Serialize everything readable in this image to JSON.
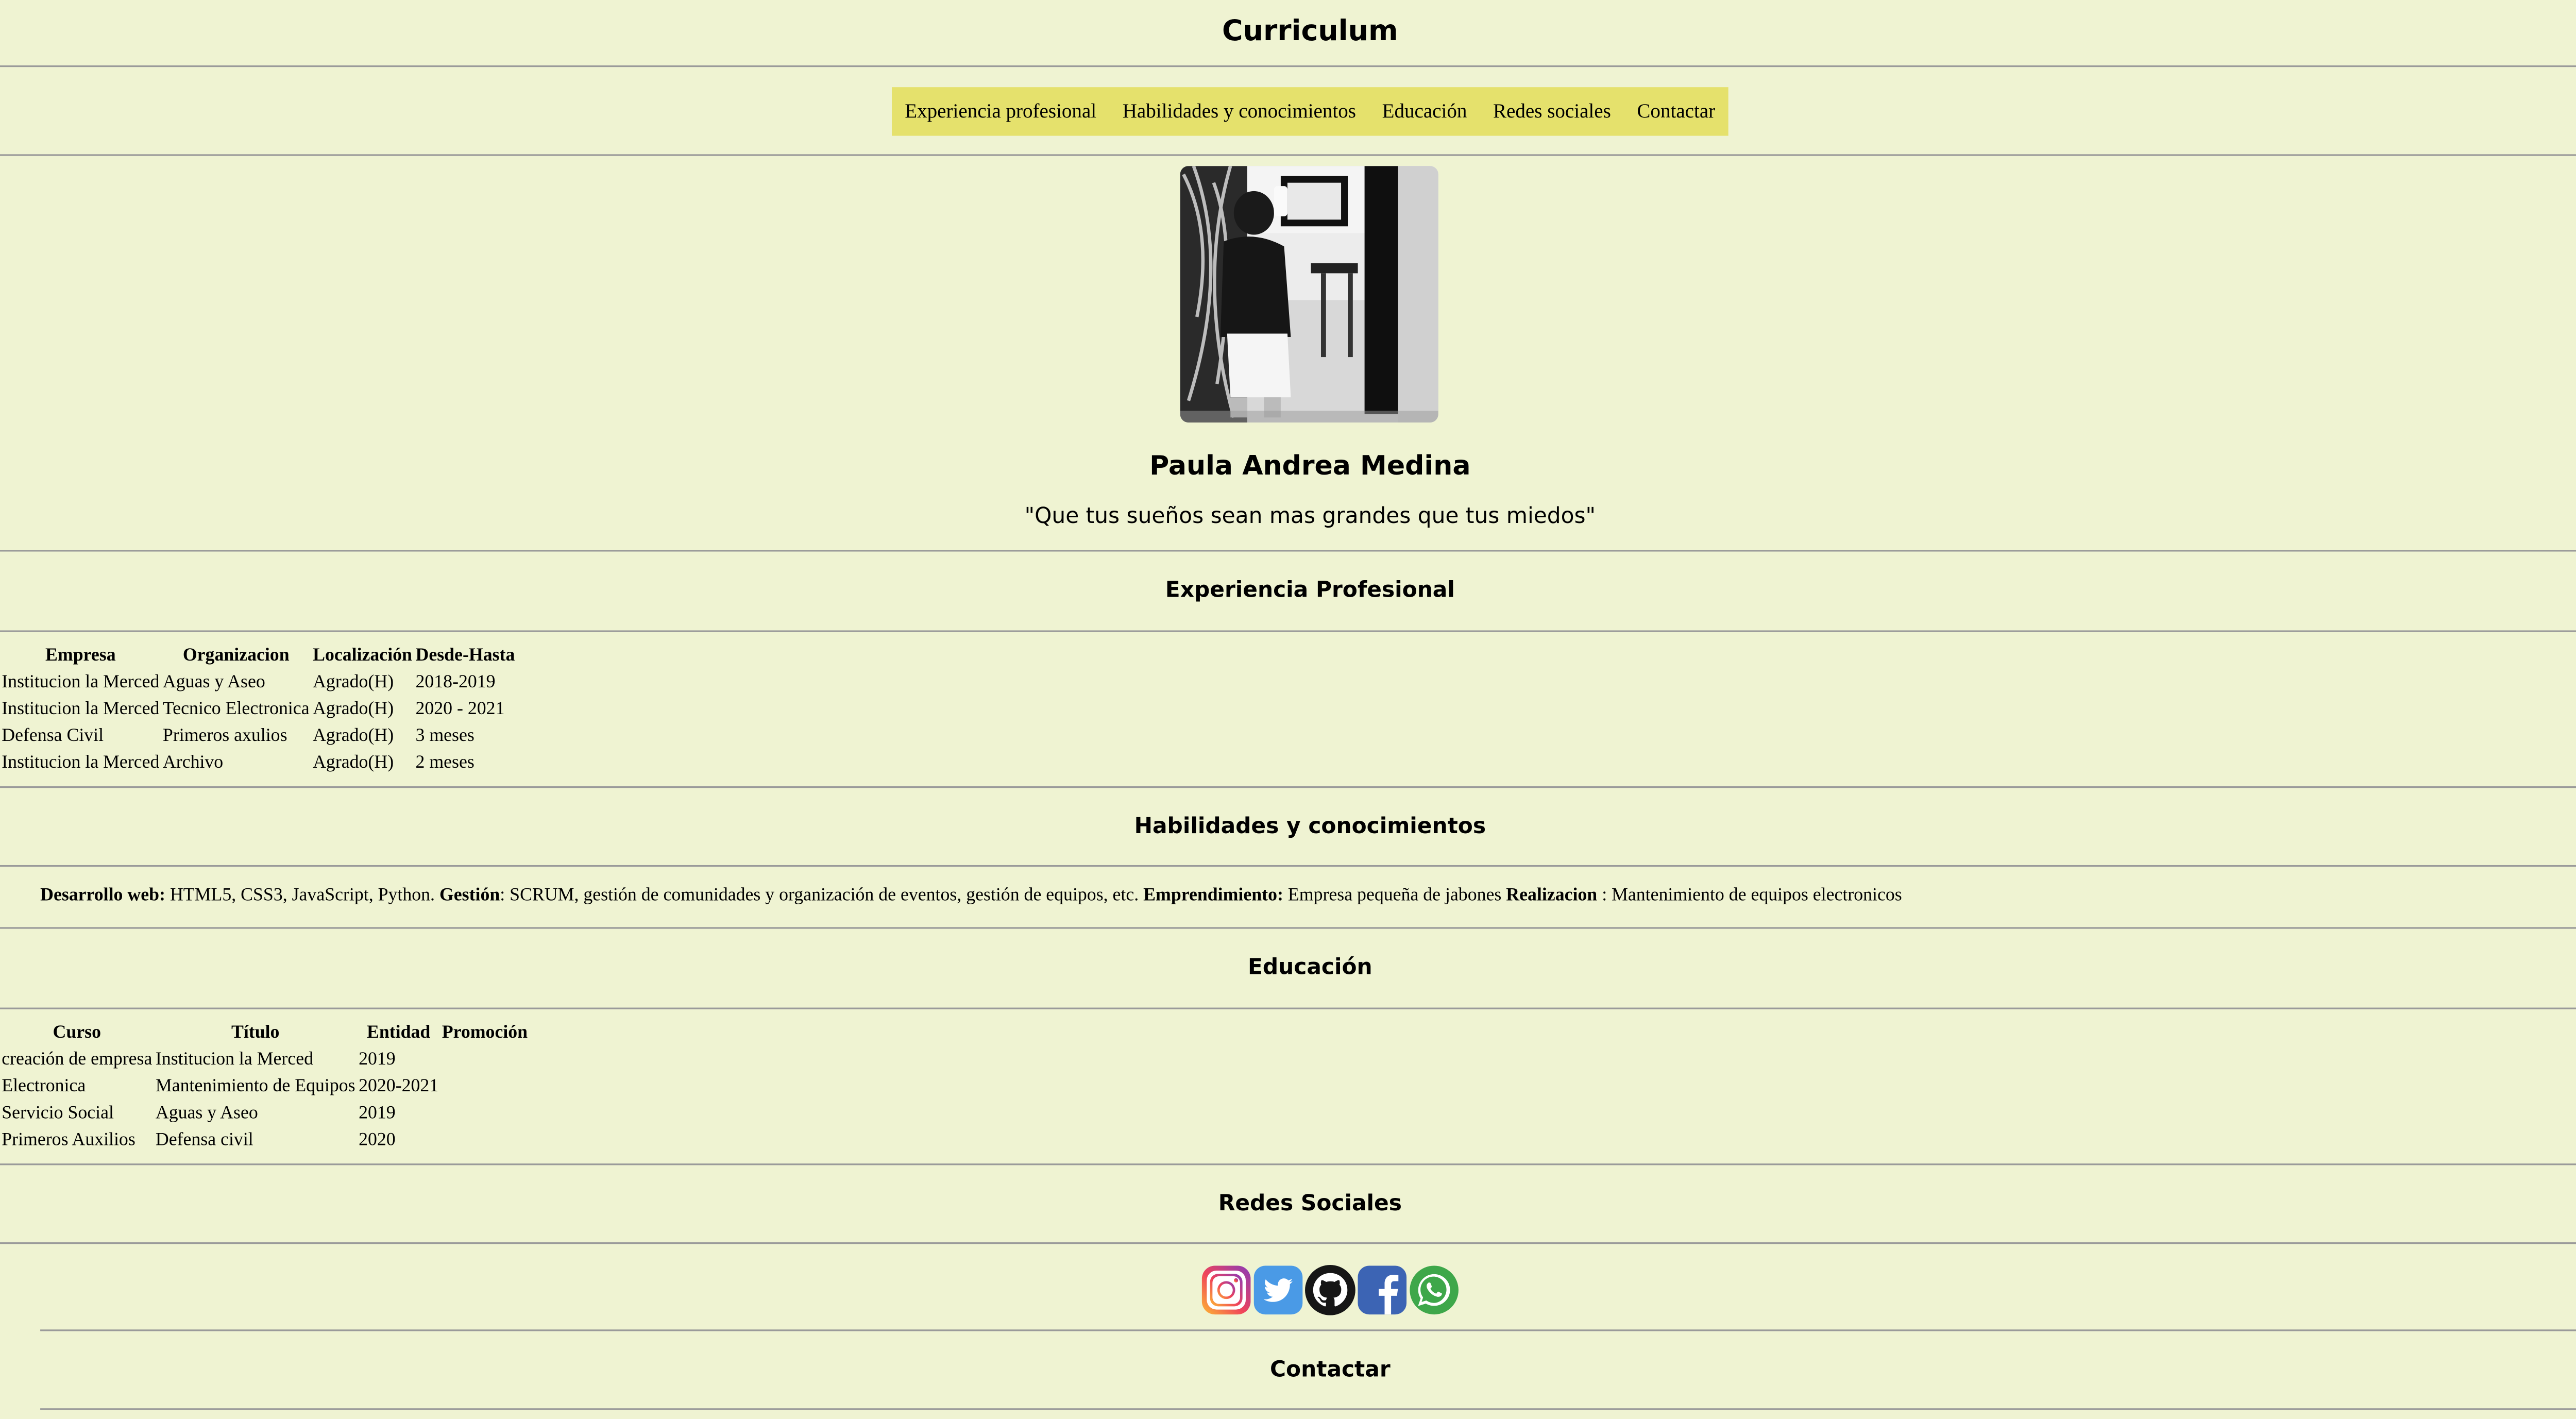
{
  "header": {
    "title": "Curriculum"
  },
  "nav": {
    "items": [
      {
        "label": "Experiencia profesional"
      },
      {
        "label": "Habilidades y conocimientos"
      },
      {
        "label": "Educación"
      },
      {
        "label": "Redes sociales"
      },
      {
        "label": "Contactar"
      }
    ]
  },
  "profile": {
    "name": "Paula Andrea Medina",
    "quote": "\"Que tus sueños sean mas grandes que tus miedos\""
  },
  "experience": {
    "title": "Experiencia Profesional",
    "columns": [
      "Empresa",
      "Organizacion",
      "Localización",
      "Desde-Hasta"
    ],
    "rows": [
      [
        "Institucion la Merced",
        "Aguas y Aseo",
        "Agrado(H)",
        "2018-2019"
      ],
      [
        "Institucion la Merced",
        "Tecnico Electronica",
        "Agrado(H)",
        "2020 - 2021"
      ],
      [
        "Defensa Civil",
        "Primeros axulios",
        "Agrado(H)",
        "3 meses"
      ],
      [
        "Institucion la Merced",
        "Archivo",
        "Agrado(H)",
        "2 meses"
      ]
    ]
  },
  "skills": {
    "title": "Habilidades y conocimientos",
    "web_label": "Desarrollo web:",
    "web_text": " HTML5, CSS3, JavaScript, Python. ",
    "gestion_label": "Gestión",
    "gestion_text": ": SCRUM, gestión de comunidades y organización de eventos, gestión de equipos, etc. ",
    "emprend_label": "Emprendimiento:",
    "emprend_text": " Empresa pequeña de jabones ",
    "realiz_label": "Realizacion",
    "realiz_text": " : Mantenimiento de equipos electronicos"
  },
  "education": {
    "title": "Educación",
    "columns": [
      "Curso",
      "Título",
      "Entidad",
      "Promoción"
    ],
    "rows": [
      [
        "creación de empresa",
        "Institucion la Merced",
        "2019"
      ],
      [
        "Electronica",
        "Mantenimiento de Equipos",
        "2020-2021"
      ],
      [
        "Servicio Social",
        "Aguas y Aseo",
        "2019"
      ],
      [
        "Primeros Auxilios",
        "Defensa civil",
        "2020"
      ]
    ]
  },
  "social": {
    "title": "Redes Sociales",
    "icons": [
      "instagram-icon",
      "twitter-icon",
      "github-icon",
      "facebook-icon",
      "whatsapp-icon"
    ]
  },
  "contact": {
    "title": "Contactar"
  },
  "colors": {
    "background": "#eff3d2",
    "nav_background": "#e5e16c",
    "rule": "#9a9a9a"
  }
}
